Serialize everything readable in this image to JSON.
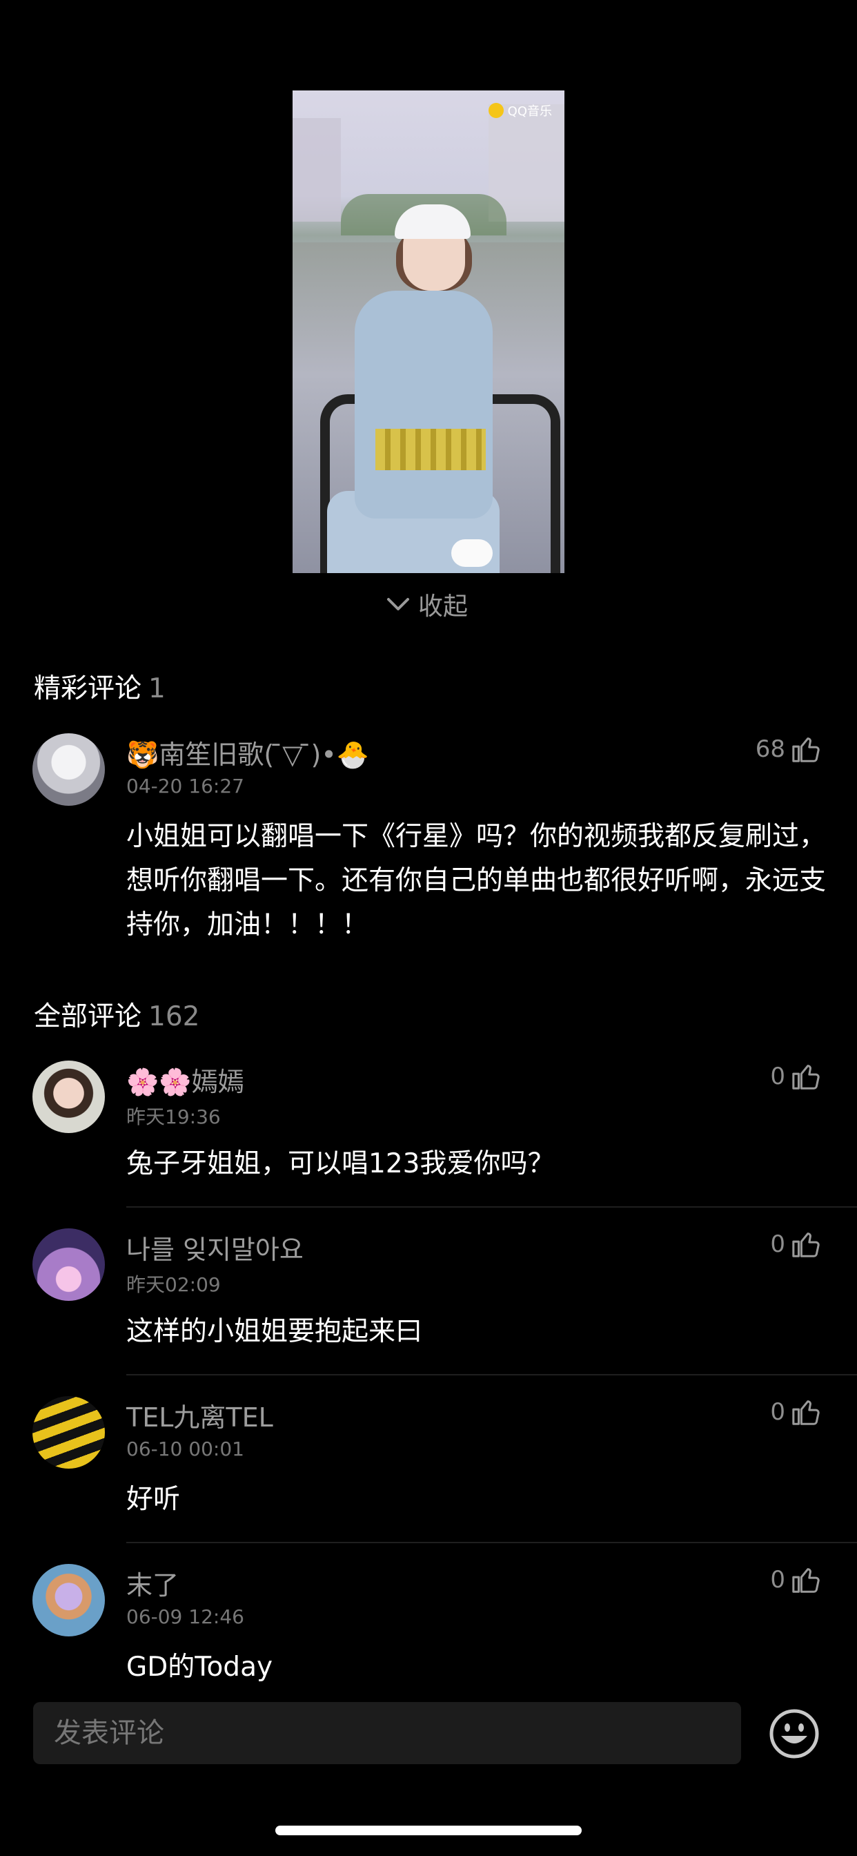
{
  "video": {
    "logo_text": "QQ音乐"
  },
  "collapse_label": "收起",
  "featured": {
    "title": "精彩评论",
    "count": "1",
    "comments": [
      {
        "name": "🐯南笙旧歌( ̄▽ ̄)•🐣",
        "time": "04-20 16:27",
        "likes": "68",
        "text": "小姐姐可以翻唱一下《行星》吗？你的视频我都反复刷过，想听你翻唱一下。还有你自己的单曲也都很好听啊，永远支持你，加油！！！！"
      }
    ]
  },
  "all": {
    "title": "全部评论",
    "count": "162",
    "comments": [
      {
        "name": "🌸🌸嫣嫣",
        "time": "昨天19:36",
        "likes": "0",
        "text": "兔子牙姐姐，可以唱123我爱你吗？"
      },
      {
        "name": "나를 잊지말아요",
        "time": "昨天02:09",
        "likes": "0",
        "text": "这样的小姐姐要抱起来曰"
      },
      {
        "name": "TEL九离TEL",
        "time": "06-10 00:01",
        "likes": "0",
        "text": "好听"
      },
      {
        "name": "末了",
        "time": "06-09 12:46",
        "likes": "0",
        "text": "GD的Today"
      }
    ]
  },
  "input_placeholder": "发表评论",
  "colors": {
    "background": "#000000",
    "muted": "#9d9d9d",
    "input_bg": "#1c1c1c"
  }
}
